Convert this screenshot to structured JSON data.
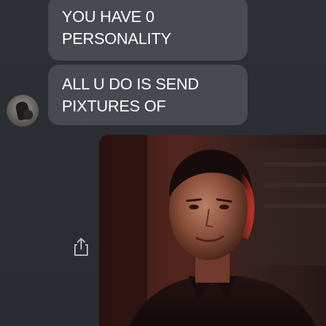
{
  "conversation": {
    "messages": [
      {
        "lines": [
          "YOU HAVE 0",
          "PERSONALITY"
        ]
      },
      {
        "lines": [
          "ALL U DO IS SEND",
          "PIXTURES OF"
        ]
      }
    ],
    "sender": {
      "avatar_icon": "user-avatar"
    },
    "attachment": {
      "type": "photo",
      "share_icon": "share-icon"
    }
  },
  "colors": {
    "background": "#2b2f33",
    "bubble": "#474b51",
    "bubble_text": "#ffffff",
    "share_icon": "#b8bcc2"
  }
}
